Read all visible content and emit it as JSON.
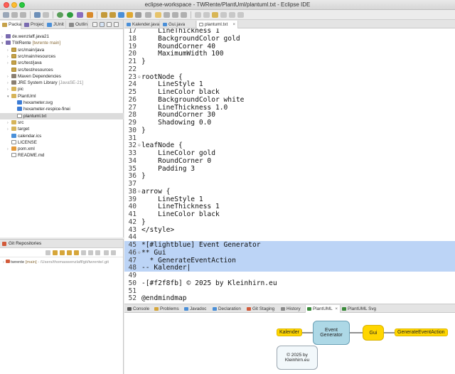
{
  "window": {
    "title": "eclipse-workspace - TWRente/PlantUml/plantuml.txt - Eclipse IDE"
  },
  "left_tabs": [
    "Packa",
    "Projec",
    "JUnit",
    "Outlin"
  ],
  "tree": [
    {
      "name": "de.wenzlaff.java21",
      "extra": "",
      "indent": 0,
      "icon": "proj",
      "arrow": ">"
    },
    {
      "name": "TWRente",
      "extra": "[twrente main]",
      "indent": 0,
      "icon": "proj",
      "arrow": "v"
    },
    {
      "name": "src/main/java",
      "extra": "",
      "indent": 1,
      "icon": "pkg",
      "arrow": ">"
    },
    {
      "name": "src/main/resources",
      "extra": "",
      "indent": 1,
      "icon": "pkg",
      "arrow": ">"
    },
    {
      "name": "src/test/java",
      "extra": "",
      "indent": 1,
      "icon": "pkg",
      "arrow": ">"
    },
    {
      "name": "src/test/resources",
      "extra": "",
      "indent": 1,
      "icon": "pkg",
      "arrow": ""
    },
    {
      "name": "Maven Dependencies",
      "extra": "",
      "indent": 1,
      "icon": "lib",
      "arrow": ">"
    },
    {
      "name": "JRE System Library",
      "extra": "[JavaSE-21]",
      "indent": 1,
      "icon": "lib",
      "arrow": ">"
    },
    {
      "name": "pic",
      "extra": "",
      "indent": 1,
      "icon": "folder",
      "arrow": ">"
    },
    {
      "name": "PlantUml",
      "extra": "",
      "indent": 1,
      "icon": "folder",
      "arrow": "v"
    },
    {
      "name": "hexameter.svg",
      "extra": "",
      "indent": 2,
      "icon": "svg",
      "arrow": ""
    },
    {
      "name": "hexameter-respice-finei",
      "extra": "",
      "indent": 2,
      "icon": "svg",
      "arrow": ""
    },
    {
      "name": "plantuml.txt",
      "extra": "",
      "indent": 2,
      "icon": "file",
      "arrow": "",
      "selected": true
    },
    {
      "name": "src",
      "extra": "",
      "indent": 1,
      "icon": "folder",
      "arrow": ">"
    },
    {
      "name": "target",
      "extra": "",
      "indent": 1,
      "icon": "folder",
      "arrow": ">"
    },
    {
      "name": "calendar.ics",
      "extra": "",
      "indent": 1,
      "icon": "cal",
      "arrow": ""
    },
    {
      "name": "LICENSE",
      "extra": "",
      "indent": 1,
      "icon": "file",
      "arrow": ""
    },
    {
      "name": "pom.xml",
      "extra": "",
      "indent": 1,
      "icon": "xml",
      "arrow": ">"
    },
    {
      "name": "README.md",
      "extra": "",
      "indent": 1,
      "icon": "file",
      "arrow": ""
    }
  ],
  "git": {
    "title": "Git Repositories",
    "repo_name": "twrente",
    "repo_branch": "[main]",
    "repo_path": "- /Users/thomaswenzlaff/git/twrente/.git"
  },
  "editor_tabs": [
    "Kalender.java",
    "Gui.java",
    "plantuml.txt"
  ],
  "code": [
    {
      "n": "17",
      "t": "    LineThickness 1",
      "f": ""
    },
    {
      "n": "18",
      "t": "    BackgroundColor gold",
      "f": ""
    },
    {
      "n": "19",
      "t": "    RoundCorner 40",
      "f": ""
    },
    {
      "n": "20",
      "t": "    MaximumWidth 100",
      "f": ""
    },
    {
      "n": "21",
      "t": "}",
      "f": ""
    },
    {
      "n": "22",
      "t": "",
      "f": ""
    },
    {
      "n": "23",
      "t": "rootNode {",
      "f": "-"
    },
    {
      "n": "24",
      "t": "    LineStyle 1",
      "f": ""
    },
    {
      "n": "25",
      "t": "    LineColor black",
      "f": ""
    },
    {
      "n": "26",
      "t": "    BackgroundColor white",
      "f": ""
    },
    {
      "n": "27",
      "t": "    LineThickness 1.0",
      "f": ""
    },
    {
      "n": "28",
      "t": "    RoundCorner 30",
      "f": ""
    },
    {
      "n": "29",
      "t": "    Shadowing 0.0",
      "f": ""
    },
    {
      "n": "30",
      "t": "}",
      "f": ""
    },
    {
      "n": "31",
      "t": "",
      "f": ""
    },
    {
      "n": "32",
      "t": "leafNode {",
      "f": "-"
    },
    {
      "n": "33",
      "t": "    LineColor gold",
      "f": ""
    },
    {
      "n": "34",
      "t": "    RoundCorner 0",
      "f": ""
    },
    {
      "n": "35",
      "t": "    Padding 3",
      "f": ""
    },
    {
      "n": "36",
      "t": "}",
      "f": ""
    },
    {
      "n": "37",
      "t": "",
      "f": ""
    },
    {
      "n": "38",
      "t": "arrow {",
      "f": "-"
    },
    {
      "n": "39",
      "t": "    LineStyle 1",
      "f": ""
    },
    {
      "n": "40",
      "t": "    LineThickness 1",
      "f": ""
    },
    {
      "n": "41",
      "t": "    LineColor black",
      "f": ""
    },
    {
      "n": "42",
      "t": "}",
      "f": ""
    },
    {
      "n": "43",
      "t": "</style>",
      "f": ""
    },
    {
      "n": "44",
      "t": "",
      "f": ""
    },
    {
      "n": "45",
      "t": "*[#lightblue] Event Generator",
      "f": "",
      "hl": true
    },
    {
      "n": "46",
      "t": "** Gui",
      "f": "-",
      "hl": true
    },
    {
      "n": "47",
      "t": "  * GenerateEventAction",
      "f": "",
      "hl": true
    },
    {
      "n": "48",
      "t": "-- Kalender|",
      "f": "",
      "hl": true
    },
    {
      "n": "49",
      "t": "",
      "f": ""
    },
    {
      "n": "50",
      "t": "-[#f2f8fb] © 2025 by Kleinhirn.eu",
      "f": ""
    },
    {
      "n": "51",
      "t": "",
      "f": ""
    },
    {
      "n": "52",
      "t": "@endmindmap",
      "f": ""
    }
  ],
  "bottom_tabs": [
    "Console",
    "Problems",
    "Javadoc",
    "Declaration",
    "Git Staging",
    "History",
    "PlantUML",
    "PlantUML Svg"
  ],
  "mindmap": {
    "left_label": "Kalender",
    "root_line1": "Event",
    "root_line2": "Generator",
    "child_label": "Gui",
    "leaf_label": "GenerateEventAction",
    "footer_line1": "© 2025 by",
    "footer_line2": "Kleinhirn.eu",
    "colors": {
      "root": "#add8e6",
      "gold": "#ffd600",
      "footer": "#f2f8fb"
    }
  }
}
